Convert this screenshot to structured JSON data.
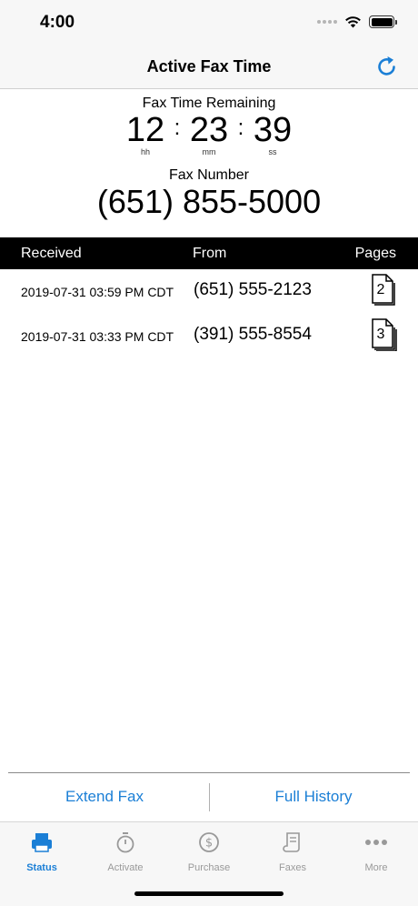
{
  "status_bar": {
    "time": "4:00"
  },
  "nav": {
    "title": "Active Fax Time",
    "refresh_icon": "refresh-icon"
  },
  "timer": {
    "label": "Fax Time Remaining",
    "hours": "12",
    "minutes": "23",
    "seconds": "39",
    "hours_unit": "hh",
    "minutes_unit": "mm",
    "seconds_unit": "ss",
    "separator": ":"
  },
  "fax": {
    "label": "Fax Number",
    "number": "(651) 855-5000"
  },
  "table": {
    "headers": {
      "received": "Received",
      "from": "From",
      "pages": "Pages"
    },
    "rows": [
      {
        "received": "2019-07-31 03:59 PM CDT",
        "from": "(651) 555-2123",
        "pages": "2"
      },
      {
        "received": "2019-07-31 03:33 PM CDT",
        "from": "(391) 555-8554",
        "pages": "3"
      }
    ]
  },
  "actions": {
    "extend": "Extend Fax",
    "history": "Full History"
  },
  "tabs": [
    {
      "label": "Status",
      "icon": "fax-machine-icon",
      "active": true
    },
    {
      "label": "Activate",
      "icon": "stopwatch-icon",
      "active": false
    },
    {
      "label": "Purchase",
      "icon": "dollar-coin-icon",
      "active": false
    },
    {
      "label": "Faxes",
      "icon": "document-scroll-icon",
      "active": false
    },
    {
      "label": "More",
      "icon": "more-dots-icon",
      "active": false
    }
  ],
  "colors": {
    "accent": "#1b7fd6",
    "header_bg": "#000000",
    "bar_bg": "#f7f7f7",
    "inactive": "#999999"
  }
}
